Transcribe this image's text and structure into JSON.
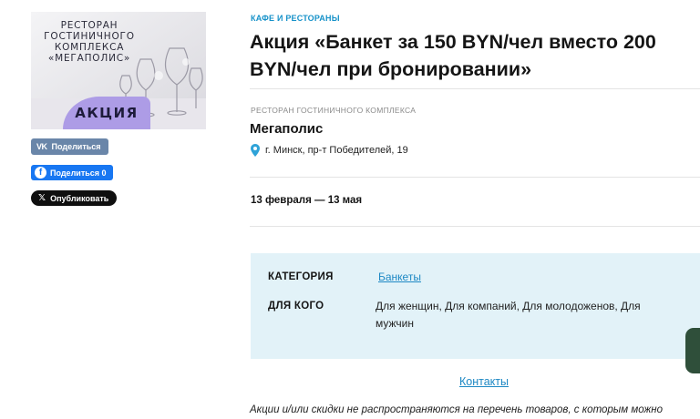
{
  "banner": {
    "title_lines": [
      "РЕСТОРАН",
      "ГОСТИНИЧНОГО",
      "КОМПЛЕКСА",
      "«МЕГАПОЛИС»"
    ],
    "badge": "АКЦИЯ",
    "accent_color": "#ad9ce6"
  },
  "share": {
    "vk_label": "Поделиться",
    "vk_icon": "VK",
    "fb_label": "Поделиться 0",
    "fb_icon": "f",
    "tw_label": "Опубликовать",
    "tw_icon": "𝕏"
  },
  "breadcrumb_category": "КАФЕ И РЕСТОРАНЫ",
  "title_lines": [
    "Акция «Банкет за 150 BYN/чел вместо 200",
    "BYN/чел при бронировании»"
  ],
  "venue": {
    "type": "РЕСТОРАН ГОСТИНИЧНОГО КОМПЛЕКСА",
    "name": "Мегаполис",
    "address": "г. Минск, пр-т Победителей, 19",
    "pin_icon": "location-pin-icon"
  },
  "dates": "13 февраля — 13 мая",
  "info": {
    "category_label": "КАТЕГОРИЯ",
    "category_value": "Банкеты",
    "audience_label": "ДЛЯ КОГО",
    "audience_lines": [
      "Для женщин, Для компаний, Для молодоженов, Для",
      "мужчин"
    ]
  },
  "contacts_link": "Контакты",
  "footnote_line": "Акции и/или скидки не распространяются на перечень товаров, с которым можно",
  "colors": {
    "link": "#1d88c4",
    "info_bg": "#e2f2f8",
    "vk": "#6a86a9",
    "fb": "#1877f2"
  }
}
